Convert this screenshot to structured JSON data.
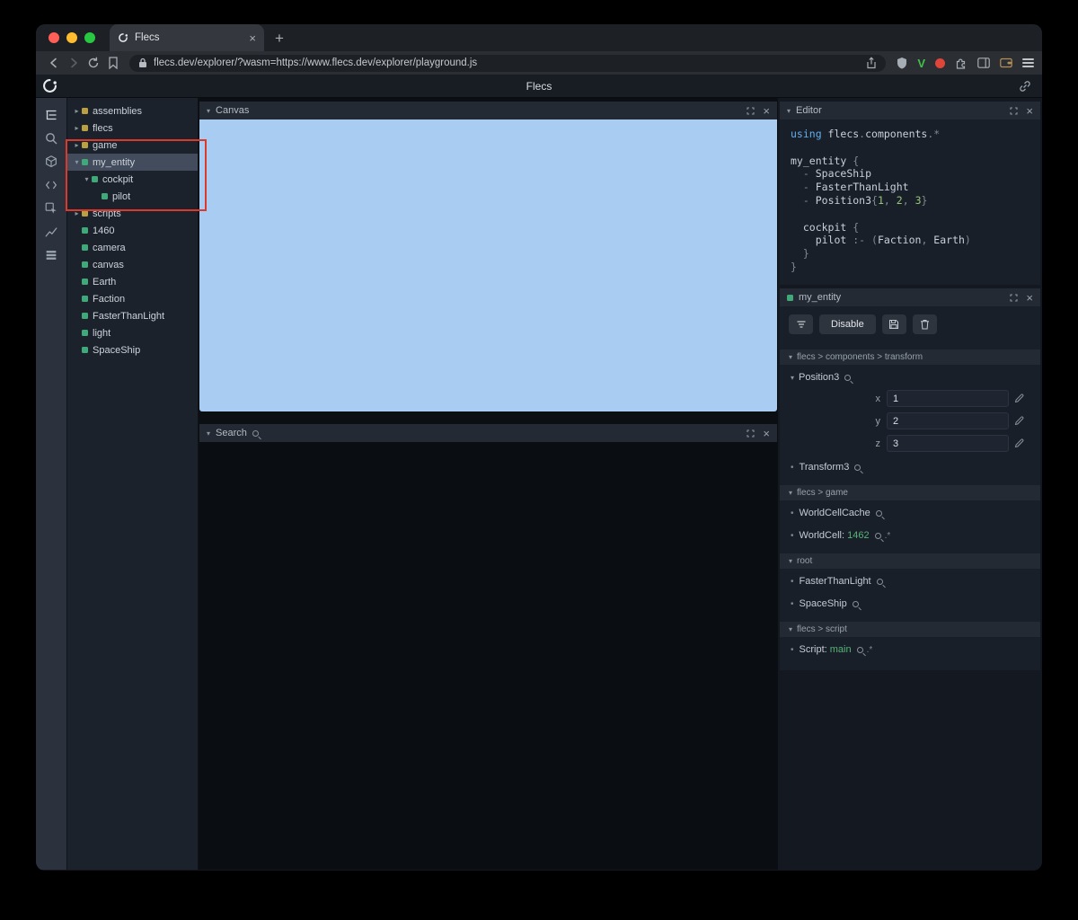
{
  "browser": {
    "tab_title": "Flecs",
    "url": "flecs.dev/explorer/?wasm=https://www.flecs.dev/explorer/playground.js",
    "extension_badge": "V"
  },
  "app": {
    "title": "Flecs"
  },
  "icons": {
    "collapsed": "▸",
    "expanded": "▾",
    "close": "×",
    "bullet": "•",
    "plus": "+"
  },
  "colors": {
    "entity_square": "#3fa97a",
    "module_square": "#b9a143",
    "canvas_blue": "#a9cdf2",
    "annotation_red": "#da392b",
    "keyword_blue": "#61aeee",
    "number_green": "#98c379",
    "value_green": "#56b377"
  },
  "tree": {
    "items": [
      {
        "label": "assemblies",
        "type": "module",
        "expander": "collapsed",
        "depth": 0
      },
      {
        "label": "flecs",
        "type": "module",
        "expander": "collapsed",
        "depth": 0
      },
      {
        "label": "game",
        "type": "module",
        "expander": "collapsed",
        "depth": 0
      },
      {
        "label": "my_entity",
        "type": "entity",
        "expander": "expanded",
        "depth": 0,
        "selected": true
      },
      {
        "label": "cockpit",
        "type": "entity",
        "expander": "expanded",
        "depth": 1
      },
      {
        "label": "pilot",
        "type": "entity",
        "expander": "none",
        "depth": 2
      },
      {
        "label": "scripts",
        "type": "module",
        "expander": "collapsed",
        "depth": 0
      },
      {
        "label": "1460",
        "type": "entity",
        "expander": "none",
        "depth": 0
      },
      {
        "label": "camera",
        "type": "entity",
        "expander": "none",
        "depth": 0
      },
      {
        "label": "canvas",
        "type": "entity",
        "expander": "none",
        "depth": 0
      },
      {
        "label": "Earth",
        "type": "entity",
        "expander": "none",
        "depth": 0
      },
      {
        "label": "Faction",
        "type": "entity",
        "expander": "none",
        "depth": 0
      },
      {
        "label": "FasterThanLight",
        "type": "entity",
        "expander": "none",
        "depth": 0
      },
      {
        "label": "light",
        "type": "entity",
        "expander": "none",
        "depth": 0
      },
      {
        "label": "SpaceShip",
        "type": "entity",
        "expander": "none",
        "depth": 0
      }
    ]
  },
  "panels": {
    "canvas": {
      "title": "Canvas"
    },
    "search": {
      "title": "Search"
    },
    "editor": {
      "title": "Editor"
    }
  },
  "editor": {
    "lines": [
      [
        [
          "using ",
          "kw"
        ],
        [
          "flecs",
          "plain"
        ],
        [
          ".",
          "p"
        ],
        [
          "components",
          "plain"
        ],
        [
          ".*",
          "p"
        ]
      ],
      [],
      [
        [
          "my_entity ",
          "plain"
        ],
        [
          "{",
          "p"
        ]
      ],
      [
        [
          "  ",
          "plain"
        ],
        [
          "- ",
          "p"
        ],
        [
          "SpaceShip",
          "plain"
        ]
      ],
      [
        [
          "  ",
          "plain"
        ],
        [
          "- ",
          "p"
        ],
        [
          "FasterThanLight",
          "plain"
        ]
      ],
      [
        [
          "  ",
          "plain"
        ],
        [
          "- ",
          "p"
        ],
        [
          "Position3",
          "plain"
        ],
        [
          "{",
          "p"
        ],
        [
          "1",
          "n"
        ],
        [
          ", ",
          "p"
        ],
        [
          "2",
          "n"
        ],
        [
          ", ",
          "p"
        ],
        [
          "3",
          "n"
        ],
        [
          "}",
          "p"
        ]
      ],
      [],
      [
        [
          "  cockpit ",
          "plain"
        ],
        [
          "{",
          "p"
        ]
      ],
      [
        [
          "    pilot ",
          "plain"
        ],
        [
          ":- ",
          "p"
        ],
        [
          "(",
          "p"
        ],
        [
          "Faction",
          "plain"
        ],
        [
          ", ",
          "p"
        ],
        [
          "Earth",
          "plain"
        ],
        [
          ")",
          "p"
        ]
      ],
      [
        [
          "  }",
          "p"
        ]
      ],
      [
        [
          "}",
          "p"
        ]
      ]
    ]
  },
  "inspector": {
    "title": "my_entity",
    "toolbar": {
      "disable_label": "Disable"
    },
    "sections": [
      {
        "path": "flecs > components > transform",
        "items": [
          {
            "kind": "component-open",
            "label": "Position3",
            "fields": [
              {
                "name": "x",
                "value": "1"
              },
              {
                "name": "y",
                "value": "2"
              },
              {
                "name": "z",
                "value": "3"
              }
            ]
          },
          {
            "kind": "component",
            "label": "Transform3"
          }
        ]
      },
      {
        "path": "flecs > game",
        "items": [
          {
            "kind": "component",
            "label": "WorldCellCache"
          },
          {
            "kind": "value",
            "label": "WorldCell:",
            "value": "1462",
            "suffix": ".*"
          }
        ]
      },
      {
        "path": "root",
        "items": [
          {
            "kind": "component",
            "label": "FasterThanLight"
          },
          {
            "kind": "component",
            "label": "SpaceShip"
          }
        ]
      },
      {
        "path": "flecs > script",
        "items": [
          {
            "kind": "value",
            "label": "Script:",
            "value": "main",
            "suffix": ".*"
          }
        ]
      }
    ]
  }
}
